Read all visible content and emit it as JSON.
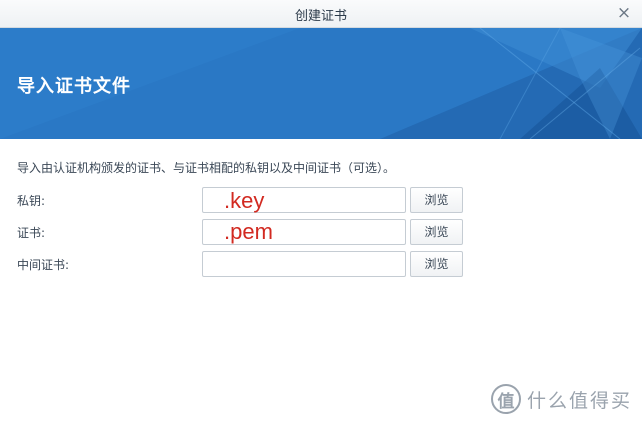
{
  "window": {
    "title": "创建证书",
    "close_icon": "×"
  },
  "banner": {
    "title": "导入证书文件",
    "colors": {
      "base": "#2a78c5",
      "dark": "#1f5fa6",
      "light": "#3d8ed6"
    }
  },
  "form": {
    "description": "导入由认证机构颁发的证书、与证书相配的私钥以及中间证书（可选）。",
    "rows": [
      {
        "label": "私钥:",
        "browse_label": "浏览",
        "annotation": ".key",
        "value": ""
      },
      {
        "label": "证书:",
        "browse_label": "浏览",
        "annotation": ".pem",
        "value": ""
      },
      {
        "label": "中间证书:",
        "browse_label": "浏览",
        "annotation": "",
        "value": ""
      }
    ],
    "annotation_color": "#d22a21"
  },
  "watermark": {
    "logo_glyph": "值",
    "text": "什么值得买"
  }
}
